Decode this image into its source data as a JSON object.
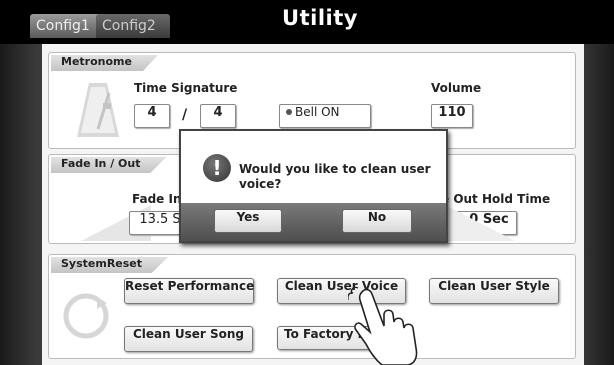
{
  "tabs": [
    {
      "label": "Config1"
    },
    {
      "label": "Config2"
    }
  ],
  "title": "Utility",
  "metronome": {
    "header": "Metronome",
    "time_signature_label": "Time Signature",
    "numerator": "4",
    "separator": "/",
    "denominator": "4",
    "bell": "Bell ON",
    "volume_label": "Volume",
    "volume": "110"
  },
  "fade": {
    "header": "Fade In / Out",
    "fade_in_label": "Fade In T",
    "fade_in_value": "13.5 S",
    "fade_out_label": "e Out Hold Time",
    "fade_out_value": "1.0 Sec"
  },
  "system_reset": {
    "header": "SystemReset",
    "buttons": [
      "Reset Performance",
      "Clean User Voice",
      "Clean User Style",
      "Clean User Song",
      "To Factory Pr"
    ]
  },
  "dialog": {
    "icon": "!",
    "message": "Would you like to clean user voice?",
    "yes": "Yes",
    "no": "No"
  },
  "icons": {
    "metronome": "metronome-icon",
    "reset": "circular-arrow-icon",
    "pointer": "hand-pointer-icon",
    "warning": "exclamation-icon"
  }
}
